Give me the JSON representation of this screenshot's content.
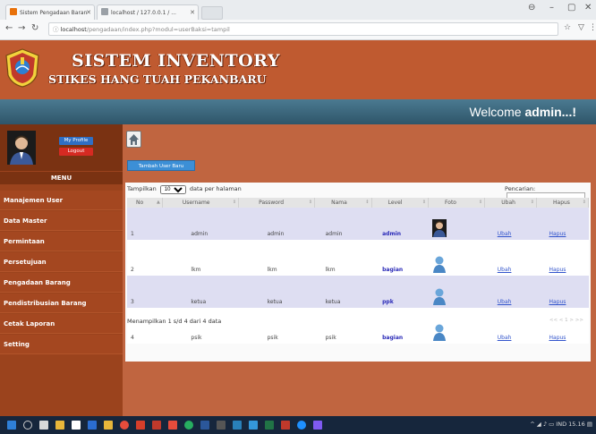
{
  "browser": {
    "tabs": [
      {
        "label": "Sistem Pengadaan Baran",
        "favicon_color": "#e8710a"
      },
      {
        "label": "localhost / 127.0.0.1 / ...",
        "favicon_color": "#9aa0a6"
      }
    ],
    "url_host": "localhost",
    "url_path": "/pengadaan/index.php?modul=userBaksi=tampil"
  },
  "header": {
    "title": "SISTEM INVENTORY",
    "subtitle": "STIKES HANG TUAH PEKANBARU"
  },
  "welcome": {
    "prefix": "Welcome ",
    "user": "admin...!"
  },
  "sidebar": {
    "profile_label": "My Profile",
    "logout_label": "Logout",
    "menu_title": "MENU",
    "items": [
      {
        "label": "Manajemen User"
      },
      {
        "label": "Data Master"
      },
      {
        "label": "Permintaan"
      },
      {
        "label": "Persetujuan"
      },
      {
        "label": "Pengadaan Barang"
      },
      {
        "label": "Pendistribusian Barang"
      },
      {
        "label": "Cetak Laporan"
      },
      {
        "label": "Setting"
      }
    ]
  },
  "main": {
    "add_button": "Tambah User Baru",
    "show_prefix": "Tampilkan",
    "show_value": "10",
    "show_suffix": "data per halaman",
    "search_label": "Pencarian:",
    "search_value": "",
    "columns": [
      "No",
      "Username",
      "Password",
      "Nama",
      "Level",
      "Foto",
      "Ubah",
      "Hapus"
    ],
    "rows": [
      {
        "no": "1",
        "username": "admin",
        "password": "admin",
        "nama": "admin",
        "level": "admin",
        "foto": "admin-photo",
        "ubah": "Ubah",
        "hapus": "Hapus"
      },
      {
        "no": "2",
        "username": "lkm",
        "password": "lkm",
        "nama": "lkm",
        "level": "bagian",
        "foto": "user-photo",
        "ubah": "Ubah",
        "hapus": "Hapus"
      },
      {
        "no": "3",
        "username": "ketua",
        "password": "ketua",
        "nama": "ketua",
        "level": "ppk",
        "foto": "user-photo",
        "ubah": "Ubah",
        "hapus": "Hapus"
      },
      {
        "no": "4",
        "username": "psik",
        "password": "psik",
        "nama": "psik",
        "level": "bagian",
        "foto": "user-photo",
        "ubah": "Ubah",
        "hapus": "Hapus"
      }
    ],
    "info": "Menampilkan 1 s/d 4 dari 4 data",
    "pagination": "<< < 1 > >>"
  },
  "taskbar": {
    "tray_text": "IND  15.16"
  }
}
